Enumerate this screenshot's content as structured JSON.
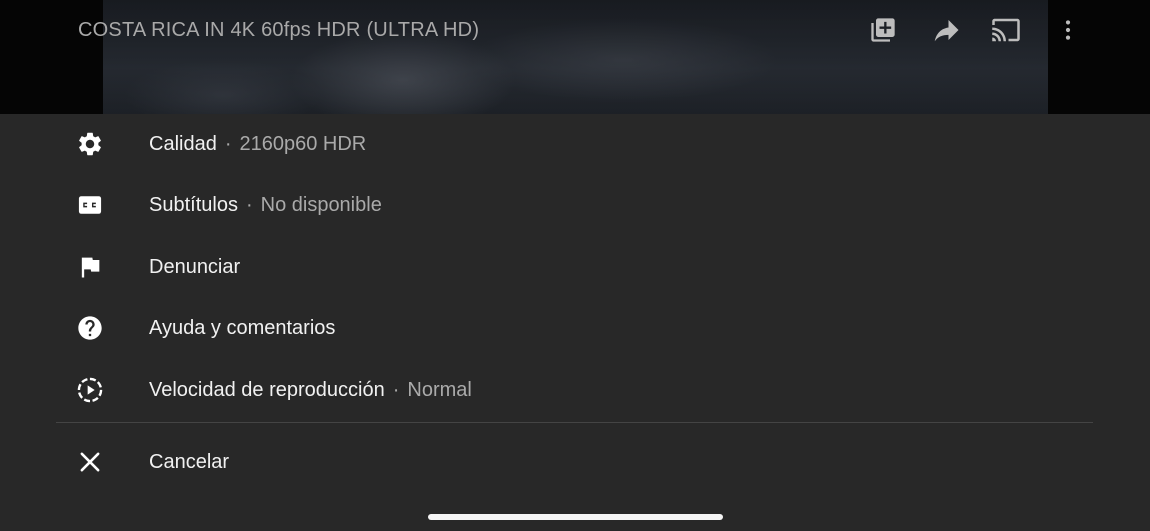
{
  "video": {
    "title": "COSTA RICA IN 4K 60fps HDR (ULTRA HD)"
  },
  "top_actions": [
    {
      "icon": "add-to-playlist-icon"
    },
    {
      "icon": "share-icon"
    },
    {
      "icon": "cast-icon"
    },
    {
      "icon": "more-vertical-icon"
    }
  ],
  "menu": {
    "items": [
      {
        "icon": "gear-icon",
        "label": "Calidad",
        "separator": "·",
        "value": "2160p60 HDR"
      },
      {
        "icon": "closed-captions-icon",
        "label": "Subtítulos",
        "separator": "·",
        "value": "No disponible"
      },
      {
        "icon": "flag-icon",
        "label": "Denunciar"
      },
      {
        "icon": "help-icon",
        "label": "Ayuda y comentarios"
      },
      {
        "icon": "playback-speed-icon",
        "label": "Velocidad de reproducción",
        "separator": "·",
        "value": "Normal"
      }
    ],
    "cancel": {
      "icon": "close-icon",
      "label": "Cancelar"
    }
  },
  "colors": {
    "sheet_background": "#282828",
    "primary_text": "#f1f1f1",
    "secondary_text": "#aaaaaa",
    "divider": "#444444"
  }
}
